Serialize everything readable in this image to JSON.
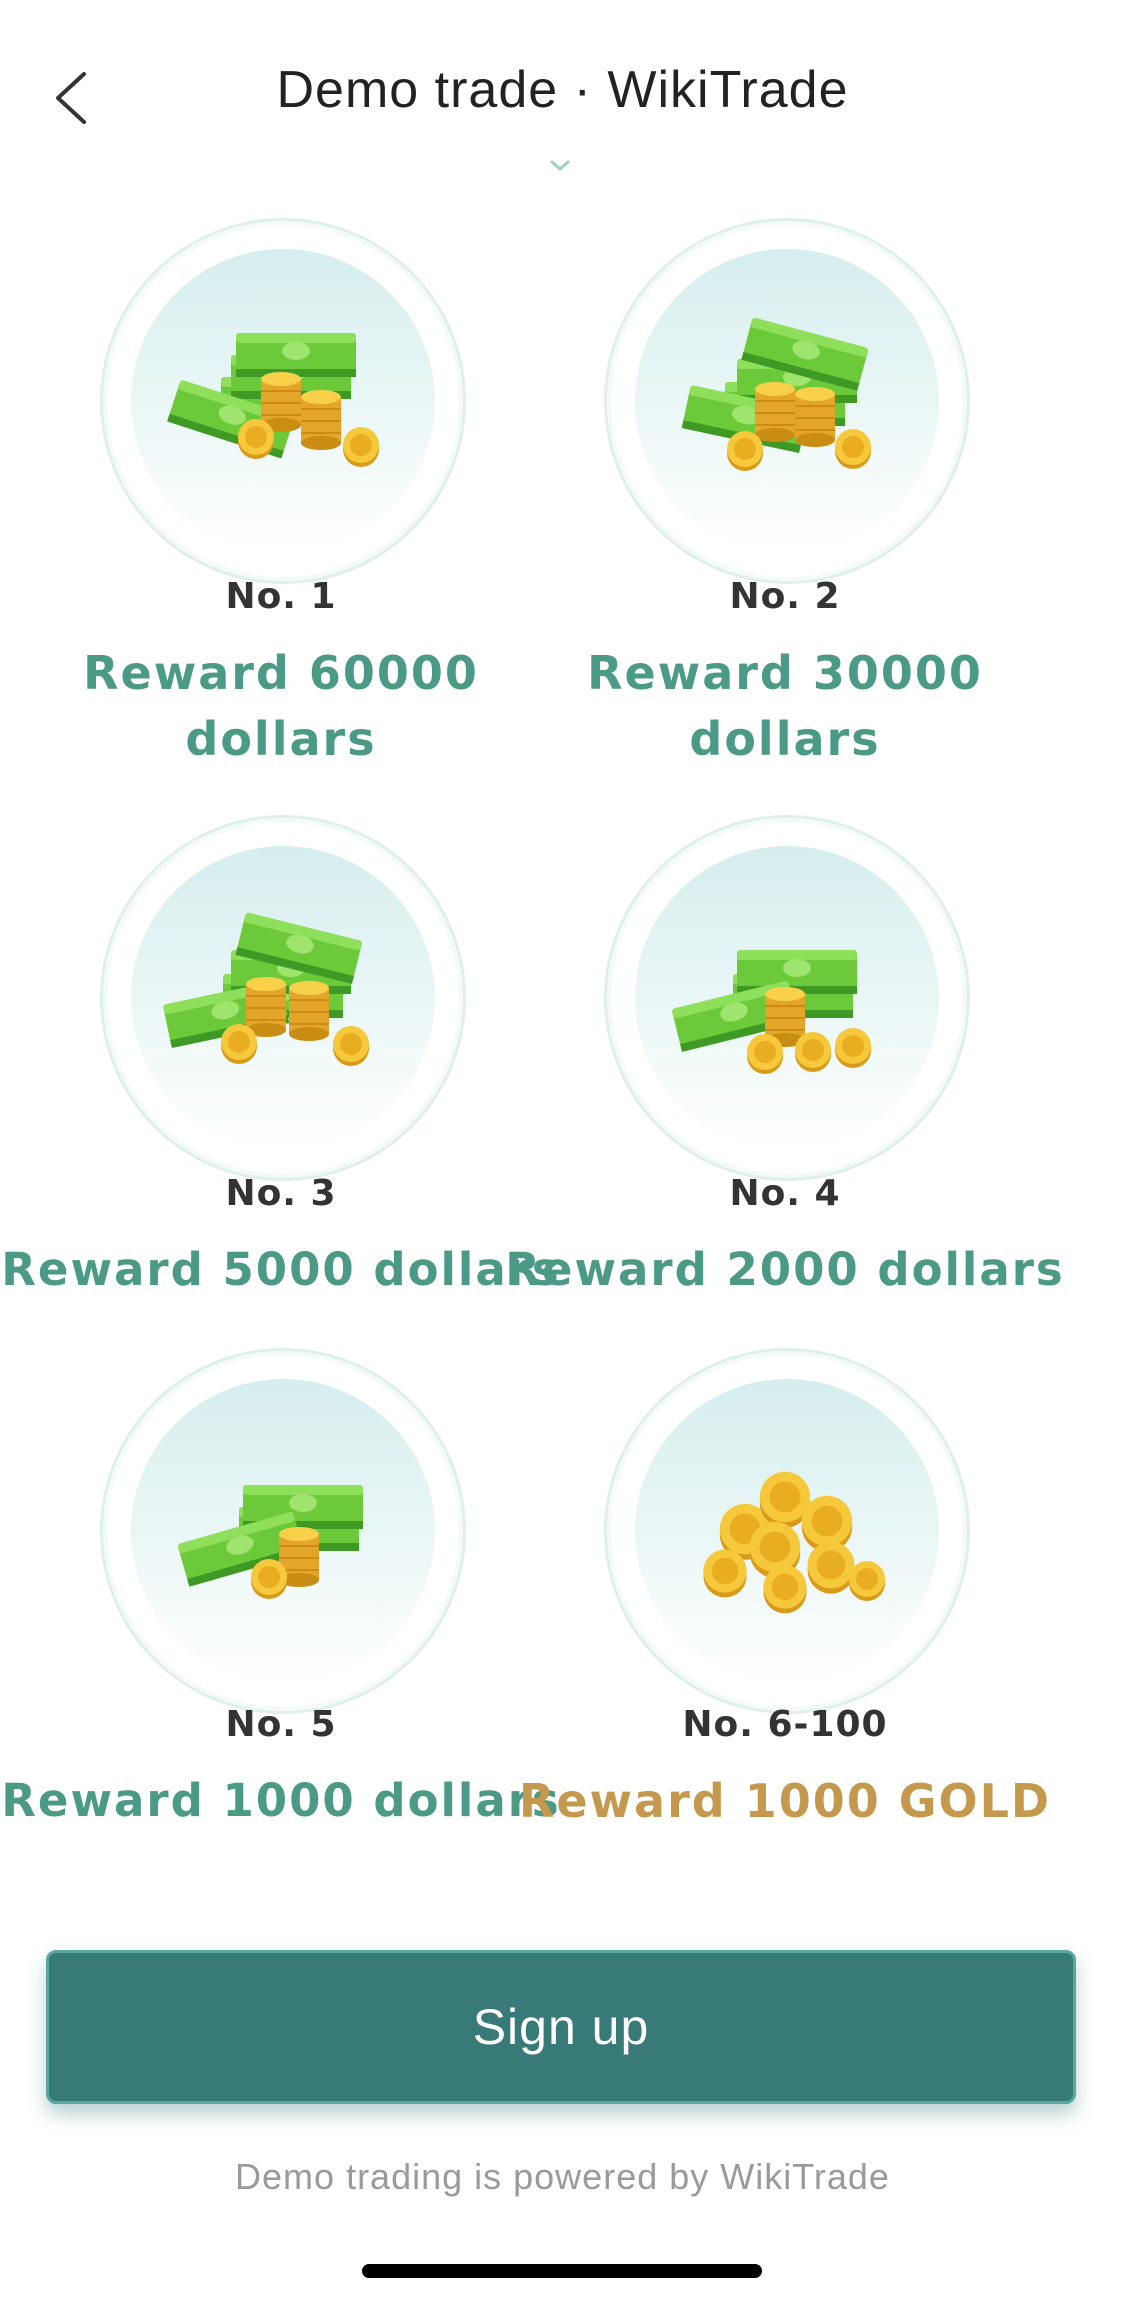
{
  "header": {
    "title": "Demo trade · WikiTrade",
    "back_icon": "chevron-left-icon"
  },
  "rewards": [
    {
      "rank": "No. 1",
      "reward": "Reward 60000 dollars",
      "icon": "money-stack-large-icon",
      "color": "#4a9a86"
    },
    {
      "rank": "No. 2",
      "reward": "Reward 30000 dollars",
      "icon": "money-stack-icon",
      "color": "#4a9a86"
    },
    {
      "rank": "No. 3",
      "reward": "Reward 5000 dollars",
      "icon": "money-stack-icon",
      "color": "#4a9a86"
    },
    {
      "rank": "No. 4",
      "reward": "Reward 2000 dollars",
      "icon": "money-stack-small-icon",
      "color": "#4a9a86"
    },
    {
      "rank": "No. 5",
      "reward": "Reward 1000 dollars",
      "icon": "money-bundle-icon",
      "color": "#4a9a86"
    },
    {
      "rank": "No. 6-100",
      "reward": "Reward 1000 GOLD",
      "icon": "gold-coins-icon",
      "color": "#c4994d"
    }
  ],
  "actions": {
    "signup_label": "Sign up"
  },
  "footer": {
    "note": "Demo trading is powered by WikiTrade"
  },
  "colors": {
    "accent": "#377a77",
    "reward_green": "#4a9a86",
    "reward_gold": "#c4994d"
  }
}
